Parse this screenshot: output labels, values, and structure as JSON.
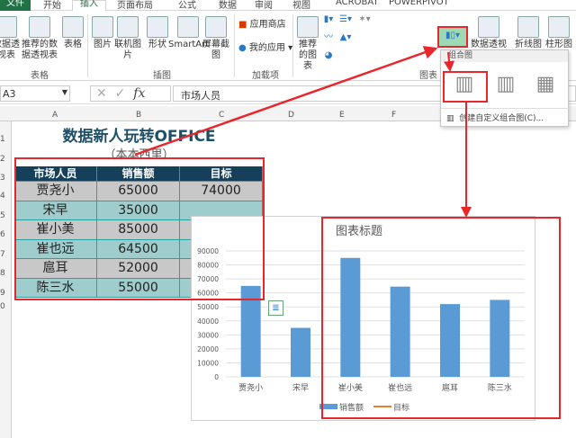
{
  "tabs": [
    "文件",
    "开始",
    "插入",
    "页面布局",
    "公式",
    "数据",
    "审阅",
    "视图",
    "ACROBAT",
    "POWERPIVOT"
  ],
  "ribbon": {
    "table_group": {
      "label": "表格",
      "buttons": [
        "数据透视表",
        "推荐的数据透视表",
        "表格"
      ]
    },
    "illustration_group": {
      "label": "插图",
      "buttons": [
        "图片",
        "联机图片",
        "形状",
        "SmartArt",
        "屏幕截图"
      ]
    },
    "addins_group": {
      "label": "加载项",
      "buttons": [
        "应用商店",
        "我的应用"
      ]
    },
    "charts_group": {
      "label": "图表",
      "buttons": [
        "推荐的图表",
        "数据透视图",
        "折线图",
        "柱形图"
      ]
    },
    "accent": "#217346"
  },
  "combo_popup": {
    "title": "组合图",
    "footer": "创建自定义组合图(C)..."
  },
  "formula_bar": {
    "name_box": "A3",
    "fx": "fx",
    "value": "市场人员"
  },
  "columns": [
    "A",
    "B",
    "C",
    "D",
    "E",
    "F",
    "G"
  ],
  "rows": [
    "1",
    "2",
    "3",
    "4",
    "5",
    "6",
    "7",
    "8",
    "9",
    "0"
  ],
  "sheet": {
    "title": "数据新人玩转OFFICE",
    "subtitle": "（本本西里）",
    "headers": [
      "市场人员",
      "销售额",
      "目标"
    ],
    "data": [
      [
        "贾尧小",
        "65000",
        "74000"
      ],
      [
        "宋早",
        "35000",
        ""
      ],
      [
        "崔小美",
        "85000",
        ""
      ],
      [
        "崔也远",
        "64500",
        ""
      ],
      [
        "扈耳",
        "52000",
        ""
      ],
      [
        "陈三水",
        "55000",
        ""
      ]
    ]
  },
  "chart_data": {
    "type": "bar",
    "title": "图表标题",
    "categories": [
      "贾尧小",
      "宋早",
      "崔小美",
      "崔也远",
      "扈耳",
      "陈三水"
    ],
    "series": [
      {
        "name": "销售额",
        "values": [
          65000,
          35000,
          85000,
          64500,
          52000,
          55000
        ],
        "color": "#5b9bd5"
      },
      {
        "name": "目标",
        "values": [
          74000
        ],
        "color": "#ed7d31",
        "render": "line"
      }
    ],
    "ylim": [
      0,
      90000
    ],
    "yticks": [
      "0",
      "10000",
      "20000",
      "30000",
      "40000",
      "50000",
      "60000",
      "70000",
      "80000",
      "90000"
    ],
    "grid": true,
    "legend": "bottom"
  }
}
